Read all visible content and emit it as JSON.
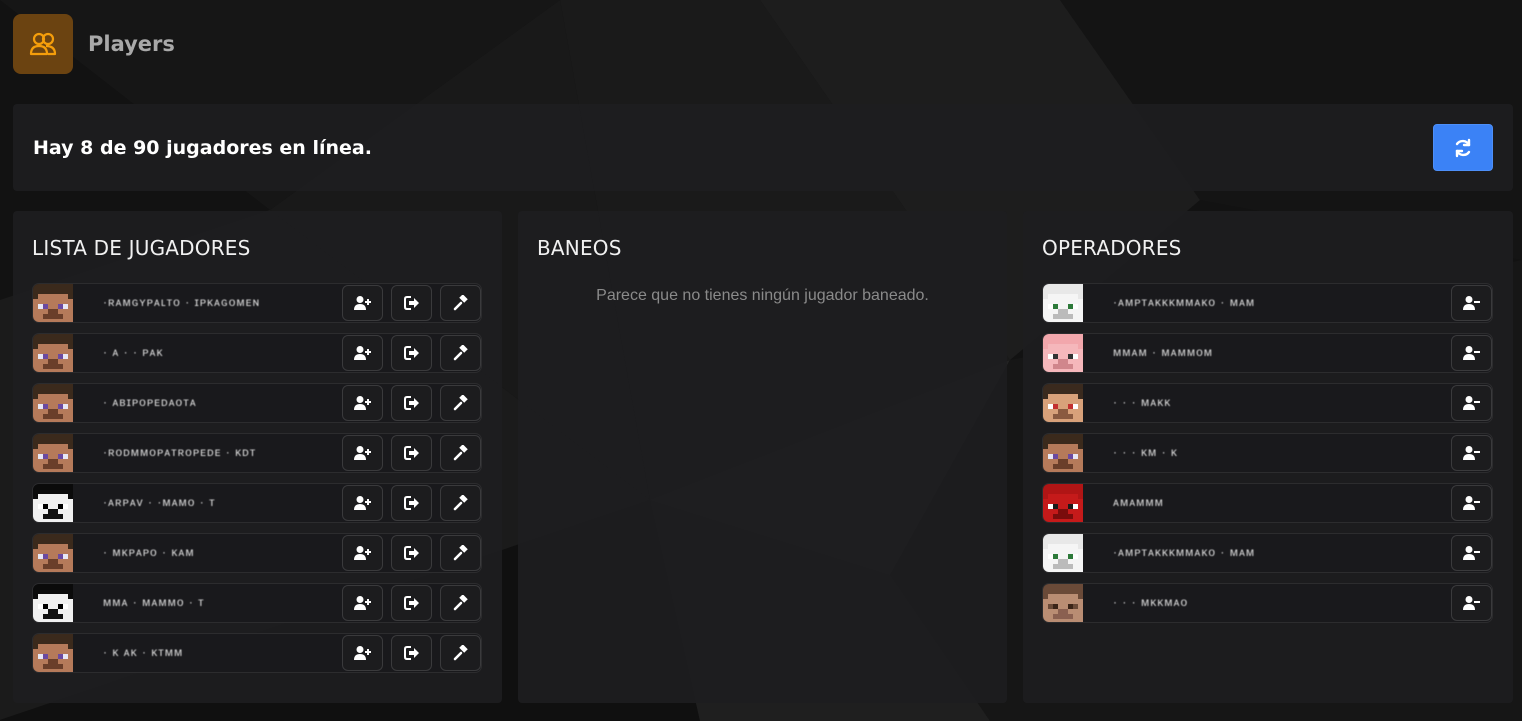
{
  "header": {
    "title": "Players",
    "icon": "users-icon"
  },
  "status": {
    "text": "Hay 8 de 90 jugadores en línea.",
    "refresh_icon": "refresh-icon"
  },
  "colors": {
    "accent": "#3b82f6",
    "header_icon_bg": "#6b4311",
    "header_icon_fg": "#f59e0b"
  },
  "players_panel": {
    "title": "LISTA DE JUGADORES",
    "actions": [
      "add-op-icon",
      "kick-icon",
      "ban-hammer-icon"
    ],
    "players": [
      {
        "name": "·ʀᴀᴍɢʏᴘᴀʟᴛᴏ · ɪᴘᴋᴀɢᴏᴍᴇɴ",
        "skin": "steve"
      },
      {
        "name": "· ᴀ · · ᴘᴀᴋ",
        "skin": "steve"
      },
      {
        "name": "· ᴀʙɪᴘᴏᴘᴇᴅᴀᴏᴛᴀ",
        "skin": "steve"
      },
      {
        "name": "·ʀᴏᴅᴍᴍᴏᴘᴀᴛʀᴏᴘᴇᴅᴇ · ᴋᴅᴛ",
        "skin": "steve"
      },
      {
        "name": "·ᴀʀᴘᴀᴠ · ·ᴍᴀᴍᴏ · ᴛ",
        "skin": "dark"
      },
      {
        "name": "· ᴍᴋᴘᴀᴘᴏ · ᴋᴀᴍ",
        "skin": "steve"
      },
      {
        "name": "ᴍᴍᴀ · ᴍᴀᴍᴍᴏ · ᴛ",
        "skin": "dark"
      },
      {
        "name": "· ᴋ ᴀᴋ · ᴋᴛᴍᴍ",
        "skin": "steve"
      }
    ]
  },
  "bans_panel": {
    "title": "BANEOS",
    "empty_text": "Parece que no tienes ningún jugador baneado."
  },
  "ops_panel": {
    "title": "OPERADORES",
    "action": "remove-op-icon",
    "operators": [
      {
        "name": "·ᴀᴍᴘᴛᴀᴋᴋᴋᴍᴍᴀᴋᴏ · ᴍᴀᴍ",
        "skin": "white"
      },
      {
        "name": "ᴍᴍᴀᴍ · ᴍᴀᴍᴍᴏᴍ",
        "skin": "pig"
      },
      {
        "name": "· · · ᴍᴀᴋᴋ",
        "skin": "spy"
      },
      {
        "name": "· · · ᴋᴍ · ᴋ",
        "skin": "steve"
      },
      {
        "name": "ᴀᴍᴀᴍᴍᴍ",
        "skin": "red"
      },
      {
        "name": "·ᴀᴍᴘᴛᴀᴋᴋᴋᴍᴍᴀᴋᴏ · ᴍᴀᴍ",
        "skin": "white"
      },
      {
        "name": "· · · ᴍᴋᴋᴍᴀᴏ",
        "skin": "brown"
      }
    ]
  }
}
